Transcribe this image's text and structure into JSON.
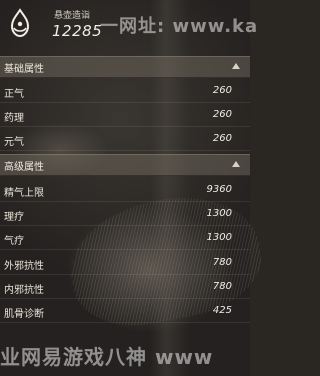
{
  "header": {
    "label": "悬壶造诣",
    "value": "12285",
    "logo_icon": "lotus-drop-icon"
  },
  "watermarks": {
    "top": "一网址: www.ka",
    "bottom": "业网易游戏八神  www"
  },
  "sections": [
    {
      "title": "基础属性",
      "rows": [
        {
          "label": "正气",
          "value": "260"
        },
        {
          "label": "药理",
          "value": "260"
        },
        {
          "label": "元气",
          "value": "260"
        }
      ]
    },
    {
      "title": "高级属性",
      "rows": [
        {
          "label": "精气上限",
          "value": "9360"
        },
        {
          "label": "理疗",
          "value": "1300"
        },
        {
          "label": "气疗",
          "value": "1300"
        },
        {
          "label": "外邪抗性",
          "value": "780"
        },
        {
          "label": "内邪抗性",
          "value": "780"
        },
        {
          "label": "肌骨诊断",
          "value": "425"
        }
      ]
    }
  ]
}
